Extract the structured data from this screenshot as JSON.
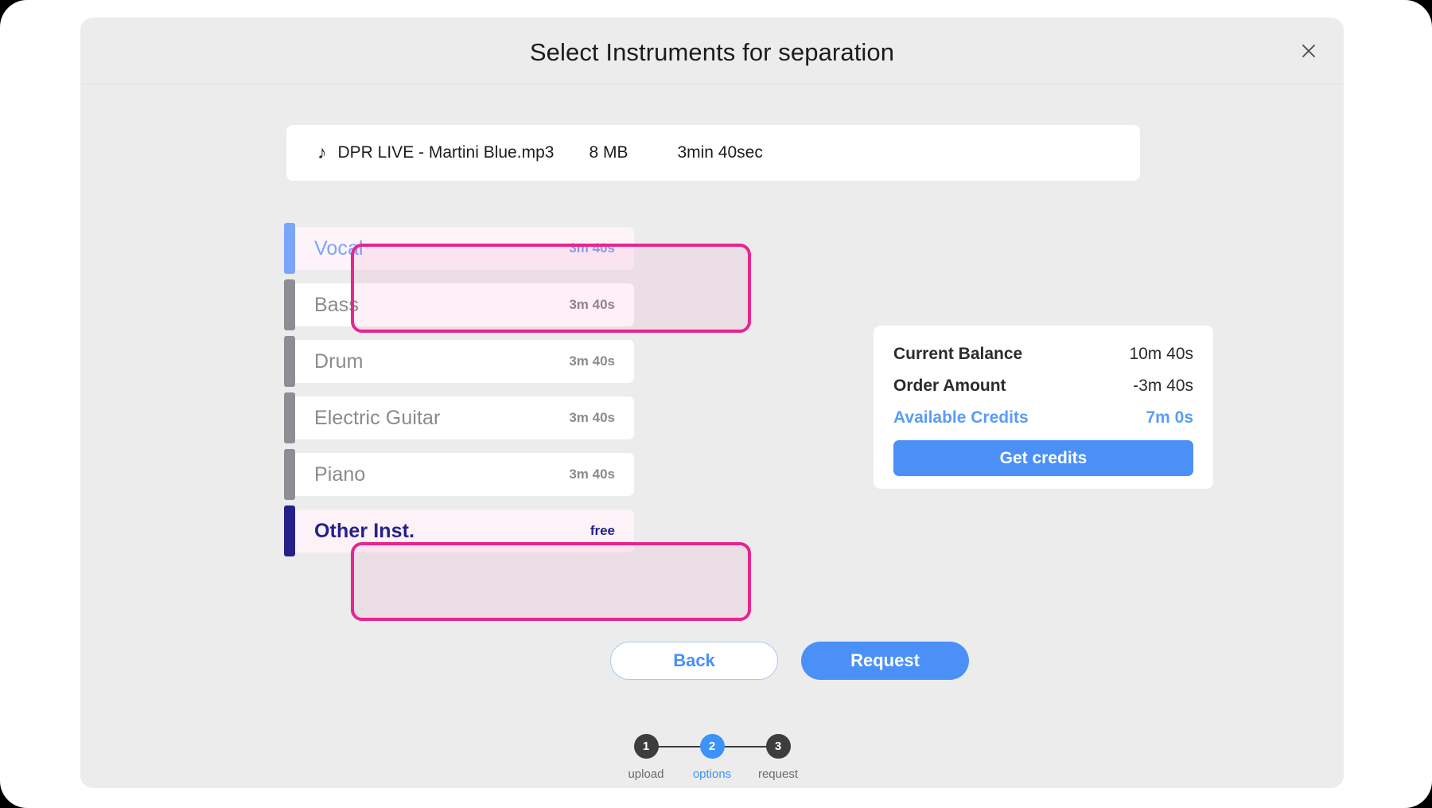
{
  "modal": {
    "title": "Select Instruments for separation",
    "close_icon": "close-icon"
  },
  "file": {
    "icon": "music-note-icon",
    "icon_glyph": "♪",
    "name": "DPR LIVE - Martini Blue.mp3",
    "size": "8 MB",
    "duration": "3min 40sec"
  },
  "instruments": [
    {
      "label": "Vocal",
      "value": "3m 40s",
      "state": "selected-vocal"
    },
    {
      "label": "Bass",
      "value": "3m 40s",
      "state": "default"
    },
    {
      "label": "Drum",
      "value": "3m 40s",
      "state": "default"
    },
    {
      "label": "Electric Guitar",
      "value": "3m 40s",
      "state": "default"
    },
    {
      "label": "Piano",
      "value": "3m 40s",
      "state": "default"
    },
    {
      "label": "Other Inst.",
      "value": "free",
      "state": "selected-other"
    }
  ],
  "balance": {
    "rows": [
      {
        "label": "Current Balance",
        "value": "10m 40s"
      },
      {
        "label": "Order Amount",
        "value": "-3m 40s"
      },
      {
        "label": "Available Credits",
        "value": "7m 0s"
      }
    ],
    "get_credits_label": "Get credits"
  },
  "actions": {
    "back_label": "Back",
    "request_label": "Request"
  },
  "stepper": {
    "steps": [
      {
        "number": "1",
        "label": "upload",
        "active": false
      },
      {
        "number": "2",
        "label": "options",
        "active": true
      },
      {
        "number": "3",
        "label": "request",
        "active": false
      }
    ]
  },
  "colors": {
    "accent_blue": "#4a90f7",
    "selected_vocal_blue": "#7ba5f8",
    "selected_other_navy": "#25218a",
    "highlight_magenta": "#e8258f",
    "muted_grey": "#8a8a8f",
    "modal_bg": "#ececec"
  }
}
